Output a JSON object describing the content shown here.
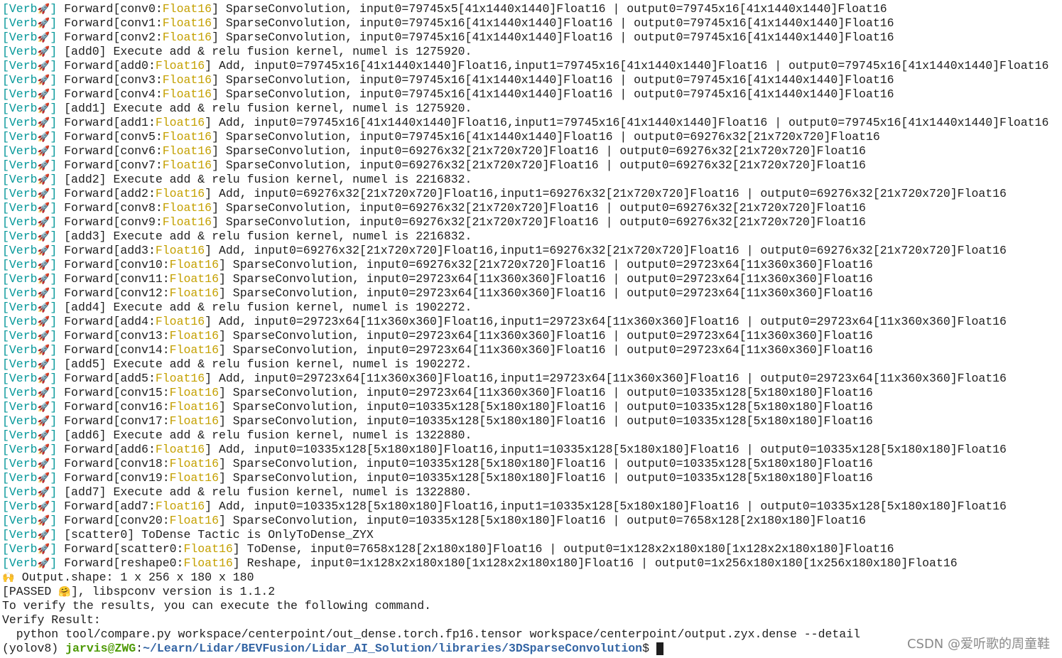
{
  "colors": {
    "text": "#1e1e1e",
    "verb": "#06989a",
    "highlight": "#c4a000",
    "user": "#4e9a06",
    "path": "#3465a4",
    "watermark": "#8a8a8a",
    "background": "#ffffff"
  },
  "terminal": {
    "verb_tag": {
      "open": "[Verb",
      "icon": "🚀",
      "icon_name": "rocket-icon",
      "close": "]"
    },
    "lines": [
      {
        "kind": "forward",
        "pre": " Forward[conv0:",
        "hl": "Float16",
        "post": "] SparseConvolution, input0=79745x5[41x1440x1440]Float16 | output0=79745x16[41x1440x1440]Float16"
      },
      {
        "kind": "forward",
        "pre": " Forward[conv1:",
        "hl": "Float16",
        "post": "] SparseConvolution, input0=79745x16[41x1440x1440]Float16 | output0=79745x16[41x1440x1440]Float16"
      },
      {
        "kind": "forward",
        "pre": " Forward[conv2:",
        "hl": "Float16",
        "post": "] SparseConvolution, input0=79745x16[41x1440x1440]Float16 | output0=79745x16[41x1440x1440]Float16"
      },
      {
        "kind": "verb",
        "text": " [add0] Execute add & relu fusion kernel, numel is 1275920."
      },
      {
        "kind": "forward",
        "pre": " Forward[add0:",
        "hl": "Float16",
        "post": "] Add, input0=79745x16[41x1440x1440]Float16,input1=79745x16[41x1440x1440]Float16 | output0=79745x16[41x1440x1440]Float16"
      },
      {
        "kind": "forward",
        "pre": " Forward[conv3:",
        "hl": "Float16",
        "post": "] SparseConvolution, input0=79745x16[41x1440x1440]Float16 | output0=79745x16[41x1440x1440]Float16"
      },
      {
        "kind": "forward",
        "pre": " Forward[conv4:",
        "hl": "Float16",
        "post": "] SparseConvolution, input0=79745x16[41x1440x1440]Float16 | output0=79745x16[41x1440x1440]Float16"
      },
      {
        "kind": "verb",
        "text": " [add1] Execute add & relu fusion kernel, numel is 1275920."
      },
      {
        "kind": "forward",
        "pre": " Forward[add1:",
        "hl": "Float16",
        "post": "] Add, input0=79745x16[41x1440x1440]Float16,input1=79745x16[41x1440x1440]Float16 | output0=79745x16[41x1440x1440]Float16"
      },
      {
        "kind": "forward",
        "pre": " Forward[conv5:",
        "hl": "Float16",
        "post": "] SparseConvolution, input0=79745x16[41x1440x1440]Float16 | output0=69276x32[21x720x720]Float16"
      },
      {
        "kind": "forward",
        "pre": " Forward[conv6:",
        "hl": "Float16",
        "post": "] SparseConvolution, input0=69276x32[21x720x720]Float16 | output0=69276x32[21x720x720]Float16"
      },
      {
        "kind": "forward",
        "pre": " Forward[conv7:",
        "hl": "Float16",
        "post": "] SparseConvolution, input0=69276x32[21x720x720]Float16 | output0=69276x32[21x720x720]Float16"
      },
      {
        "kind": "verb",
        "text": " [add2] Execute add & relu fusion kernel, numel is 2216832."
      },
      {
        "kind": "forward",
        "pre": " Forward[add2:",
        "hl": "Float16",
        "post": "] Add, input0=69276x32[21x720x720]Float16,input1=69276x32[21x720x720]Float16 | output0=69276x32[21x720x720]Float16"
      },
      {
        "kind": "forward",
        "pre": " Forward[conv8:",
        "hl": "Float16",
        "post": "] SparseConvolution, input0=69276x32[21x720x720]Float16 | output0=69276x32[21x720x720]Float16"
      },
      {
        "kind": "forward",
        "pre": " Forward[conv9:",
        "hl": "Float16",
        "post": "] SparseConvolution, input0=69276x32[21x720x720]Float16 | output0=69276x32[21x720x720]Float16"
      },
      {
        "kind": "verb",
        "text": " [add3] Execute add & relu fusion kernel, numel is 2216832."
      },
      {
        "kind": "forward",
        "pre": " Forward[add3:",
        "hl": "Float16",
        "post": "] Add, input0=69276x32[21x720x720]Float16,input1=69276x32[21x720x720]Float16 | output0=69276x32[21x720x720]Float16"
      },
      {
        "kind": "forward",
        "pre": " Forward[conv10:",
        "hl": "Float16",
        "post": "] SparseConvolution, input0=69276x32[21x720x720]Float16 | output0=29723x64[11x360x360]Float16"
      },
      {
        "kind": "forward",
        "pre": " Forward[conv11:",
        "hl": "Float16",
        "post": "] SparseConvolution, input0=29723x64[11x360x360]Float16 | output0=29723x64[11x360x360]Float16"
      },
      {
        "kind": "forward",
        "pre": " Forward[conv12:",
        "hl": "Float16",
        "post": "] SparseConvolution, input0=29723x64[11x360x360]Float16 | output0=29723x64[11x360x360]Float16"
      },
      {
        "kind": "verb",
        "text": " [add4] Execute add & relu fusion kernel, numel is 1902272."
      },
      {
        "kind": "forward",
        "pre": " Forward[add4:",
        "hl": "Float16",
        "post": "] Add, input0=29723x64[11x360x360]Float16,input1=29723x64[11x360x360]Float16 | output0=29723x64[11x360x360]Float16"
      },
      {
        "kind": "forward",
        "pre": " Forward[conv13:",
        "hl": "Float16",
        "post": "] SparseConvolution, input0=29723x64[11x360x360]Float16 | output0=29723x64[11x360x360]Float16"
      },
      {
        "kind": "forward",
        "pre": " Forward[conv14:",
        "hl": "Float16",
        "post": "] SparseConvolution, input0=29723x64[11x360x360]Float16 | output0=29723x64[11x360x360]Float16"
      },
      {
        "kind": "verb",
        "text": " [add5] Execute add & relu fusion kernel, numel is 1902272."
      },
      {
        "kind": "forward",
        "pre": " Forward[add5:",
        "hl": "Float16",
        "post": "] Add, input0=29723x64[11x360x360]Float16,input1=29723x64[11x360x360]Float16 | output0=29723x64[11x360x360]Float16"
      },
      {
        "kind": "forward",
        "pre": " Forward[conv15:",
        "hl": "Float16",
        "post": "] SparseConvolution, input0=29723x64[11x360x360]Float16 | output0=10335x128[5x180x180]Float16"
      },
      {
        "kind": "forward",
        "pre": " Forward[conv16:",
        "hl": "Float16",
        "post": "] SparseConvolution, input0=10335x128[5x180x180]Float16 | output0=10335x128[5x180x180]Float16"
      },
      {
        "kind": "forward",
        "pre": " Forward[conv17:",
        "hl": "Float16",
        "post": "] SparseConvolution, input0=10335x128[5x180x180]Float16 | output0=10335x128[5x180x180]Float16"
      },
      {
        "kind": "verb",
        "text": " [add6] Execute add & relu fusion kernel, numel is 1322880."
      },
      {
        "kind": "forward",
        "pre": " Forward[add6:",
        "hl": "Float16",
        "post": "] Add, input0=10335x128[5x180x180]Float16,input1=10335x128[5x180x180]Float16 | output0=10335x128[5x180x180]Float16"
      },
      {
        "kind": "forward",
        "pre": " Forward[conv18:",
        "hl": "Float16",
        "post": "] SparseConvolution, input0=10335x128[5x180x180]Float16 | output0=10335x128[5x180x180]Float16"
      },
      {
        "kind": "forward",
        "pre": " Forward[conv19:",
        "hl": "Float16",
        "post": "] SparseConvolution, input0=10335x128[5x180x180]Float16 | output0=10335x128[5x180x180]Float16"
      },
      {
        "kind": "verb",
        "text": " [add7] Execute add & relu fusion kernel, numel is 1322880."
      },
      {
        "kind": "forward",
        "pre": " Forward[add7:",
        "hl": "Float16",
        "post": "] Add, input0=10335x128[5x180x180]Float16,input1=10335x128[5x180x180]Float16 | output0=10335x128[5x180x180]Float16"
      },
      {
        "kind": "forward",
        "pre": " Forward[conv20:",
        "hl": "Float16",
        "post": "] SparseConvolution, input0=10335x128[5x180x180]Float16 | output0=7658x128[2x180x180]Float16"
      },
      {
        "kind": "verb",
        "text": " [scatter0] ToDense Tactic is OnlyToDense_ZYX"
      },
      {
        "kind": "forward",
        "pre": " Forward[scatter0:",
        "hl": "Float16",
        "post": "] ToDense, input0=7658x128[2x180x180]Float16 | output0=1x128x2x180x180[1x128x2x180x180]Float16"
      },
      {
        "kind": "forward",
        "pre": " Forward[reshape0:",
        "hl": "Float16",
        "post": "] Reshape, input0=1x128x2x180x180[1x128x2x180x180]Float16 | output0=1x256x180x180[1x256x180x180]Float16"
      },
      {
        "kind": "icon_text",
        "pre": "",
        "icon": "🙌",
        "icon_name": "raising-hands-icon",
        "post": " Output.shape: 1 x 256 x 180 x 180"
      },
      {
        "kind": "icon_text",
        "pre": "[PASSED ",
        "icon": "🤗",
        "icon_name": "hugging-face-icon",
        "post": "], libspconv version is 1.1.2"
      },
      {
        "kind": "plain",
        "text": "To verify the results, you can execute the following command."
      },
      {
        "kind": "plain",
        "text": "Verify Result:"
      },
      {
        "kind": "plain",
        "text": "  python tool/compare.py workspace/centerpoint/out_dense.torch.fp16.tensor workspace/centerpoint/output.zyx.dense --detail"
      }
    ],
    "prompt": {
      "env": "(yolov8) ",
      "user_host": "jarvis@ZWG",
      "sep": ":",
      "path": "~/Learn/Lidar/BEVFusion/Lidar_AI_Solution/libraries/3DSparseConvolution",
      "dollar": "$ "
    }
  },
  "watermark": "CSDN @爱听歌的周童鞋"
}
